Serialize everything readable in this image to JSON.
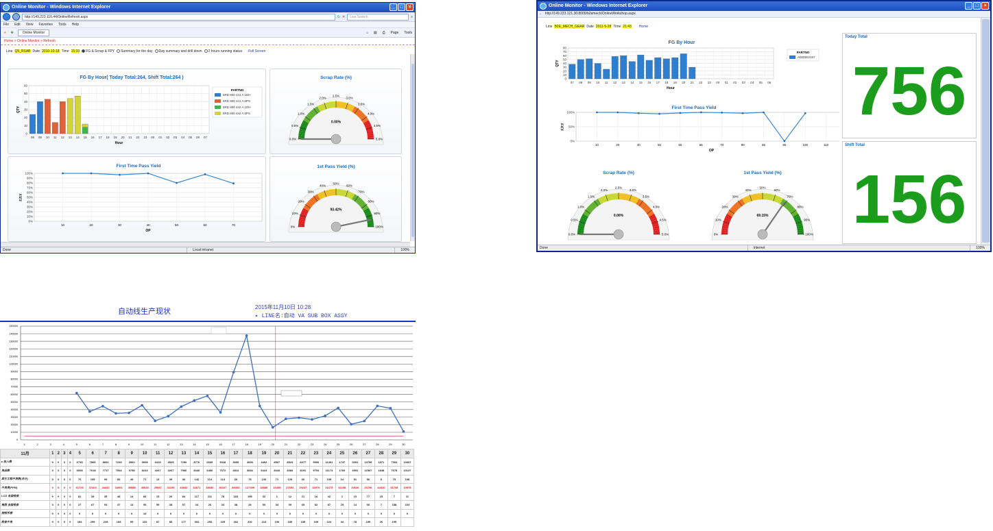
{
  "window1": {
    "title": "Online Monitor - Windows Internet Explorer",
    "url": "http://149.223.116.44/OnlineRefresh.aspx",
    "search_placeholder": "Live Search",
    "menu": [
      "File",
      "Edit",
      "View",
      "Favorites",
      "Tools",
      "Help"
    ],
    "tab_label": "Online Monitor",
    "tools": [
      "Page",
      "Tools"
    ],
    "breadcrumb": "Home > Online Monitor > Refresh",
    "line_label": "Line",
    "line_value": "Q5_RSAB",
    "date_label": "Date",
    "date_value": "2010-10-18",
    "time_label": "Time",
    "time_value": "15:33",
    "radios": [
      "FG & Scrap & FPY",
      "Summary for the day",
      "Day summary and drill down",
      "2 hours running status"
    ],
    "fullscreen": "Full Screen",
    "status_left": "Done",
    "status_zone": "Local intranet",
    "status_zoom": "100%"
  },
  "window2": {
    "title": "Online Monitor - Windows Internet Explorer",
    "url": "http://149.223.121.36:8000/b2emech/OnlineWorkshop.aspx",
    "line_label": "Line",
    "line_value": "B2E_MECH_GEAR",
    "date_label": "Date",
    "date_value": "2011-5-28",
    "time_label": "Time",
    "time_value": "21:43",
    "home": "Home",
    "today_total_label": "Today Total",
    "today_total_value": "756",
    "shift_total_label": "Shift Total",
    "shift_total_value": "156",
    "status_left": "Done",
    "status_zone": "Internet",
    "status_zoom": "100%"
  },
  "window3": {
    "title": "自动线生产现状",
    "datetime": "2015年11月10日 10:28",
    "line_name": "▸ LINE名:自动 VA SUB BOX ASSY",
    "month_label": "11月",
    "days": [
      "1",
      "2",
      "3",
      "4",
      "5",
      "6",
      "7",
      "8",
      "9",
      "10",
      "11",
      "12",
      "13",
      "14",
      "15",
      "16",
      "17",
      "18",
      "19",
      "20",
      "21",
      "22",
      "23",
      "24",
      "25",
      "26",
      "27",
      "28",
      "29",
      "30"
    ],
    "rows": [
      {
        "label": "▸ 投入数",
        "vals": [
          "0",
          "0",
          "0",
          "0",
          "6735",
          "7866",
          "8832",
          "7249",
          "3962",
          "9008",
          "6415",
          "4525",
          "7290",
          "8776",
          "6669",
          "9318",
          "3695",
          "4008",
          "4462",
          "8567",
          "8524",
          "8377",
          "9900",
          "11461",
          "1747",
          "3091",
          "13796",
          "1871",
          "7304",
          "10397"
        ],
        "red": false
      },
      {
        "label": "良品数",
        "vals": [
          "0",
          "0",
          "0",
          "0",
          "6008",
          "7618",
          "7717",
          "7534",
          "5758",
          "8243",
          "4267",
          "4267",
          "7566",
          "8446",
          "6466",
          "7672",
          "4814",
          "3684",
          "6424",
          "8444",
          "8383",
          "8191",
          "9704",
          "11174",
          "1760",
          "4991",
          "12567",
          "1848",
          "7678",
          "10137"
        ],
        "red": false
      },
      {
        "label": "其它工程不良数(合计)",
        "vals": [
          "0",
          "0",
          "0",
          "0",
          "76",
          "195",
          "99",
          "83",
          "49",
          "71",
          "13",
          "39",
          "36",
          "142",
          "114",
          "113",
          "69",
          "78",
          "133",
          "71",
          "129",
          "60",
          "71",
          "105",
          "14",
          "51",
          "56",
          "6",
          "75",
          "108"
        ],
        "red": false
      },
      {
        "label": "不良率(PPM)",
        "vals": [
          "0",
          "0",
          "0",
          "0",
          "61726",
          "37403",
          "44447",
          "34991",
          "35588",
          "45628",
          "25097",
          "31195",
          "43842",
          "42871",
          "38680",
          "36167",
          "89303",
          "127499",
          "44686",
          "16459",
          "27694",
          "29247",
          "32970",
          "31673",
          "42158",
          "20626",
          "24796",
          "44810",
          "41708",
          "10978"
        ],
        "red": true
      },
      {
        "label": "LCD 全面检查",
        "vals": [
          "0",
          "0",
          "0",
          "0",
          "81",
          "28",
          "35",
          "48",
          "14",
          "66",
          "15",
          "26",
          "84",
          "117",
          "111",
          "78",
          "163",
          "199",
          "32",
          "1",
          "12",
          "21",
          "16",
          "42",
          "1",
          "13",
          "77",
          "15",
          "7",
          "11"
        ],
        "red": false
      },
      {
        "label": "电阻 全面检查",
        "vals": [
          "0",
          "0",
          "0",
          "0",
          "27",
          "67",
          "94",
          "37",
          "13",
          "95",
          "59",
          "38",
          "57",
          "44",
          "26",
          "34",
          "38",
          "28",
          "50",
          "34",
          "39",
          "69",
          "82",
          "87",
          "29",
          "14",
          "66",
          "7",
          "188",
          "103"
        ],
        "red": false
      },
      {
        "label": "按钮手感",
        "vals": [
          "0",
          "0",
          "0",
          "0",
          "0",
          "0",
          "0",
          "0",
          "0",
          "19",
          "0",
          "0",
          "0",
          "0",
          "0",
          "0",
          "0",
          "0",
          "0",
          "0",
          "0",
          "0",
          "0",
          "0",
          "0",
          "0",
          "0",
          "0",
          "0",
          "0"
        ],
        "red": false
      },
      {
        "label": "检查不良",
        "vals": [
          "0",
          "0",
          "0",
          "0",
          "184",
          "299",
          "228",
          "168",
          "95",
          "232",
          "87",
          "85",
          "177",
          "303",
          "253",
          "225",
          "262",
          "310",
          "213",
          "106",
          "180",
          "155",
          "169",
          "224",
          "44",
          "78",
          "199",
          "26",
          "195",
          ""
        ],
        "red": false
      }
    ]
  },
  "chart_data": [
    {
      "type": "bar",
      "title": "FG By Hour( Today Total:264, Shift Total:264 )",
      "xlabel": "Hour",
      "ylabel": "QTY",
      "ylim": [
        0,
        60
      ],
      "categories": [
        "08",
        "09",
        "10",
        "11",
        "12",
        "13",
        "14",
        "15",
        "16",
        "17",
        "18",
        "19",
        "20",
        "21",
        "22",
        "23",
        "00",
        "01",
        "02",
        "03",
        "04",
        "05",
        "06",
        "07"
      ],
      "legend_title": "PARTNO",
      "series": [
        {
          "name": "5RD 800 441 A 1DH",
          "color": "#2f7fd0",
          "values": [
            24,
            40,
            0,
            0,
            0,
            0,
            0,
            0,
            0,
            0,
            0,
            0,
            0,
            0,
            0,
            0,
            0,
            0,
            0,
            0,
            0,
            0,
            0,
            0
          ]
        },
        {
          "name": "5RD 800 441 A 6PS",
          "color": "#e0603a",
          "values": [
            0,
            0,
            43,
            14,
            40,
            0,
            0,
            0,
            0,
            0,
            0,
            0,
            0,
            0,
            0,
            0,
            0,
            0,
            0,
            0,
            0,
            0,
            0,
            0
          ]
        },
        {
          "name": "5RD 800 442 A 1DH",
          "color": "#3cb84a",
          "values": [
            0,
            0,
            0,
            0,
            0,
            0,
            0,
            8,
            0,
            0,
            0,
            0,
            0,
            0,
            0,
            0,
            0,
            0,
            0,
            0,
            0,
            0,
            0,
            0
          ]
        },
        {
          "name": "5RD 800 442 A 6PS",
          "color": "#d4d43a",
          "values": [
            0,
            0,
            0,
            0,
            0,
            44,
            47,
            4,
            0,
            0,
            0,
            0,
            0,
            0,
            0,
            0,
            0,
            0,
            0,
            0,
            0,
            0,
            0,
            0
          ]
        }
      ]
    },
    {
      "type": "line",
      "title": "First Time Pass Yield",
      "xlabel": "OP",
      "ylabel": "F.P.Y",
      "ylim": [
        0,
        100
      ],
      "x": [
        10,
        20,
        30,
        40,
        50,
        60,
        70
      ],
      "series": [
        {
          "name": "",
          "values": [
            100,
            100,
            97,
            100,
            80,
            98,
            79
          ]
        }
      ]
    },
    {
      "type": "gauge",
      "title": "Scrap Rate (%)",
      "ticks": [
        "0.0%",
        "0.5%",
        "1.0%",
        "1.5%",
        "2.0%",
        "2.5%",
        "3.0%",
        "3.5%",
        "4.0%",
        "4.5%",
        "5.0%"
      ],
      "value": 0.0,
      "value_label": "0.00%"
    },
    {
      "type": "gauge",
      "title": "1st Pass Yield (%)",
      "ticks": [
        "0%",
        "10%",
        "20%",
        "30%",
        "40%",
        "50%",
        "60%",
        "70%",
        "80%",
        "90%",
        "100%"
      ],
      "value": 93.42,
      "value_label": "93.42%"
    },
    {
      "type": "bar",
      "title": "FG By Hour",
      "xlabel": "Hour",
      "ylabel": "QTY",
      "ylim": [
        0,
        80
      ],
      "categories": [
        "07",
        "08",
        "09",
        "10",
        "11",
        "12",
        "13",
        "14",
        "15",
        "16",
        "17",
        "18",
        "19",
        "20",
        "21",
        "22",
        "23",
        "00",
        "01",
        "02",
        "03",
        "04",
        "05",
        "06"
      ],
      "legend_title": "PARTNO",
      "series": [
        {
          "name": "A000902167",
          "color": "#2f7fd0",
          "values": [
            38,
            50,
            52,
            40,
            25,
            58,
            60,
            45,
            62,
            48,
            55,
            52,
            55,
            65,
            30,
            0,
            0,
            0,
            0,
            0,
            0,
            0,
            0,
            0
          ]
        }
      ]
    },
    {
      "type": "line",
      "title": "First Time Pass Yield",
      "xlabel": "OP",
      "ylabel": "F.P.Y",
      "ylim": [
        0,
        100
      ],
      "x": [
        10,
        20,
        40,
        50,
        60,
        65,
        70,
        80,
        85,
        90,
        100,
        110
      ],
      "series": [
        {
          "name": "",
          "values": [
            100,
            100,
            97,
            95,
            98,
            100,
            99,
            97,
            100,
            0,
            97,
            null
          ]
        }
      ]
    },
    {
      "type": "gauge",
      "title": "Scrap Rate (%)",
      "ticks": [
        "0.0%",
        "0.5%",
        "1.0%",
        "1.5%",
        "2.0%",
        "2.5%",
        "3.0%",
        "3.5%",
        "4.0%",
        "4.5%",
        "5.0%"
      ],
      "value": 0.0,
      "value_label": "0.00%"
    },
    {
      "type": "gauge",
      "title": "1st Pass Yield (%)",
      "ticks": [
        "0%",
        "10%",
        "20%",
        "30%",
        "40%",
        "50%",
        "60%",
        "70%",
        "80%",
        "90%",
        "100%"
      ],
      "value": 69.15,
      "value_label": "69.15%"
    },
    {
      "type": "line",
      "title": "",
      "xlabel": "",
      "ylabel": "",
      "ylim": [
        0,
        150000
      ],
      "yticks": [
        "0",
        "10000",
        "20000",
        "30000",
        "40000",
        "50000",
        "60000",
        "70000",
        "80000",
        "90000",
        "100000",
        "110000",
        "120000",
        "130000",
        "140000",
        "150000"
      ],
      "x": [
        1,
        2,
        3,
        4,
        5,
        6,
        7,
        8,
        9,
        10,
        11,
        12,
        13,
        14,
        15,
        16,
        17,
        18,
        19,
        20,
        21,
        22,
        23,
        24,
        25,
        26,
        27,
        28,
        29,
        30
      ],
      "series": [
        {
          "name": "",
          "color": "#3a6fc0",
          "values": [
            null,
            null,
            null,
            null,
            61726,
            37403,
            44447,
            34991,
            35588,
            45628,
            25097,
            31195,
            43842,
            52000,
            58000,
            36167,
            89303,
            137499,
            44686,
            16459,
            27694,
            29247,
            26970,
            31673,
            42158,
            20626,
            24796,
            44810,
            41708,
            10978
          ]
        },
        {
          "name": "",
          "color": "#e04060",
          "values": [
            5000,
            5000,
            5000,
            5000,
            5000,
            5000,
            5000,
            5000,
            5000,
            5000,
            5000,
            5000,
            5000,
            5000,
            5000,
            5000,
            5000,
            5000,
            5000,
            5000,
            5000,
            5000,
            5000,
            5000,
            5000,
            5000,
            5000,
            5000,
            5000,
            5000
          ]
        }
      ]
    }
  ]
}
